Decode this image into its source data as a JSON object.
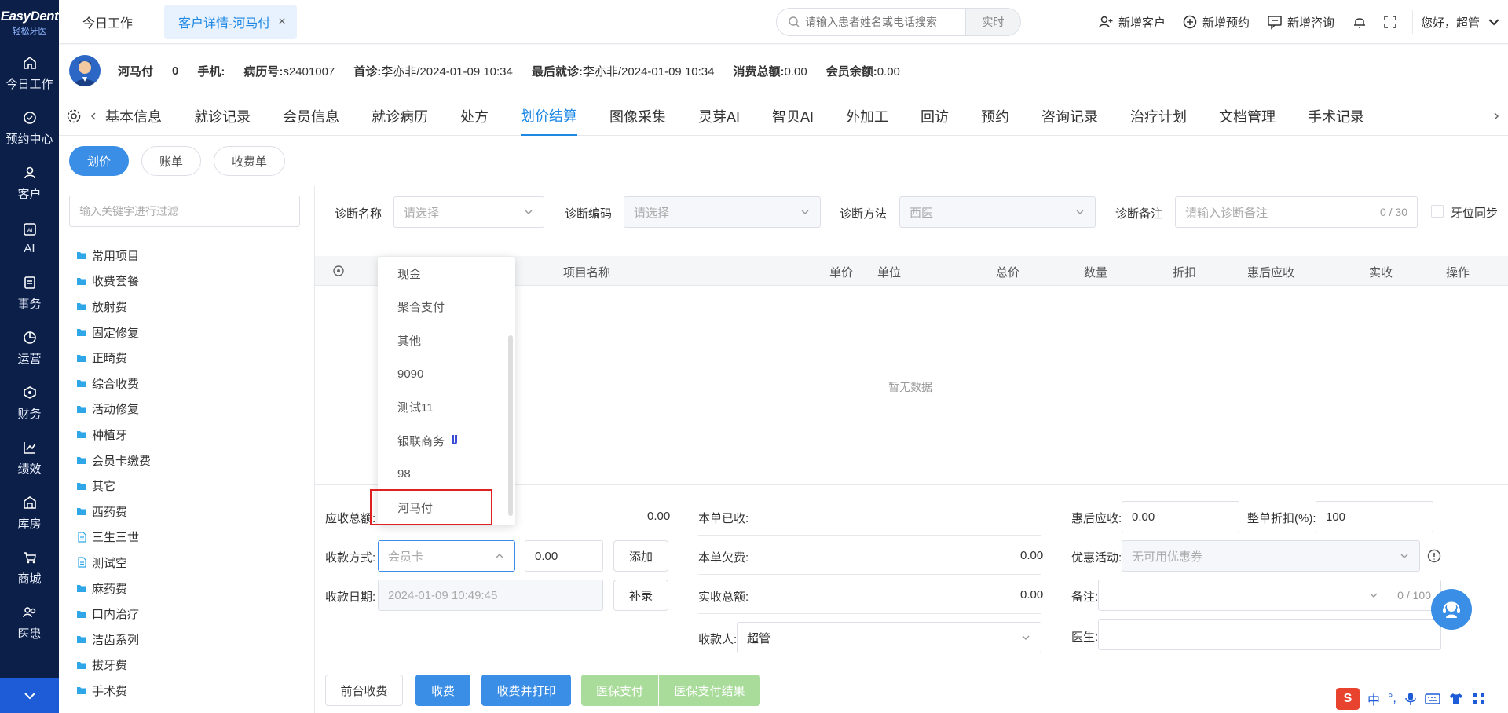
{
  "logo": {
    "line1": "EasyDent",
    "line2": "轻松牙医"
  },
  "leftnav": {
    "items": [
      {
        "label": "今日工作",
        "icon": "home-icon"
      },
      {
        "label": "预约中心",
        "icon": "calendar-icon"
      },
      {
        "label": "客户",
        "icon": "user-icon"
      },
      {
        "label": "AI",
        "icon": "ai-icon"
      },
      {
        "label": "事务",
        "icon": "task-icon"
      },
      {
        "label": "运营",
        "icon": "pie-icon"
      },
      {
        "label": "财务",
        "icon": "wallet-icon"
      },
      {
        "label": "绩效",
        "icon": "chart-icon"
      },
      {
        "label": "库房",
        "icon": "warehouse-icon"
      },
      {
        "label": "商城",
        "icon": "cart-icon"
      },
      {
        "label": "医患",
        "icon": "people-icon"
      }
    ]
  },
  "topbar": {
    "tabs": [
      {
        "label": "今日工作"
      },
      {
        "label": "客户详情-河马付",
        "close": "×"
      }
    ],
    "search": {
      "placeholder": "请输入患者姓名或电话搜索",
      "mode": "实时"
    },
    "actions": {
      "new_customer": "新增客户",
      "new_appointment": "新增预约",
      "new_consult": "新增咨询",
      "greeting": "您好，超管"
    }
  },
  "patient": {
    "name": "河马付",
    "count": "0",
    "phone_label": "手机:",
    "record_label": "病历号:",
    "record_no": "s2401007",
    "first_visit_label": "首诊:",
    "first_visit": "李亦非/2024-01-09 10:34",
    "last_visit_label": "最后就诊:",
    "last_visit": "李亦非/2024-01-09 10:34",
    "total_spend_label": "消费总额:",
    "total_spend": "0.00",
    "member_balance_label": "会员余额:",
    "member_balance": "0.00"
  },
  "module_tabs": [
    "基本信息",
    "就诊记录",
    "会员信息",
    "就诊病历",
    "处方",
    "划价结算",
    "图像采集",
    "灵芽AI",
    "智贝AI",
    "外加工",
    "回访",
    "预约",
    "咨询记录",
    "治疗计划",
    "文档管理",
    "手术记录"
  ],
  "module_tabs_active": "划价结算",
  "sub_tabs": [
    "划价",
    "账单",
    "收费单"
  ],
  "category": {
    "filter_placeholder": "输入关键字进行过滤",
    "items": [
      {
        "label": "常用项目",
        "type": "folder"
      },
      {
        "label": "收费套餐",
        "type": "folder"
      },
      {
        "label": "放射费",
        "type": "folder"
      },
      {
        "label": "固定修复",
        "type": "folder"
      },
      {
        "label": "正畸费",
        "type": "folder"
      },
      {
        "label": "综合收费",
        "type": "folder"
      },
      {
        "label": "活动修复",
        "type": "folder"
      },
      {
        "label": "种植牙",
        "type": "folder"
      },
      {
        "label": "会员卡缴费",
        "type": "folder"
      },
      {
        "label": "其它",
        "type": "folder"
      },
      {
        "label": "西药费",
        "type": "folder"
      },
      {
        "label": "三生三世",
        "type": "file"
      },
      {
        "label": "测试空",
        "type": "file"
      },
      {
        "label": "麻药费",
        "type": "folder"
      },
      {
        "label": "口内治疗",
        "type": "folder"
      },
      {
        "label": "洁齿系列",
        "type": "folder"
      },
      {
        "label": "拔牙费",
        "type": "folder"
      },
      {
        "label": "手术费",
        "type": "folder"
      }
    ]
  },
  "diagnosis": {
    "name_label": "诊断名称",
    "name_placeholder": "请选择",
    "code_label": "诊断编码",
    "code_placeholder": "请选择",
    "method_label": "诊断方法",
    "method_value": "西医",
    "remark_label": "诊断备注",
    "remark_placeholder": "请输入诊断备注",
    "remark_count": "0 / 30",
    "tooth_sync_label": "牙位同步"
  },
  "grid": {
    "headers": [
      "项目名称",
      "单价",
      "单位",
      "总价",
      "数量",
      "折扣",
      "惠后应收",
      "实收",
      "操作"
    ],
    "empty": "暂无数据"
  },
  "summary": {
    "receivable_label": "应收总额:",
    "receivable_value": "0.00",
    "paid_label": "本单已收:",
    "owed_label": "本单欠费:",
    "owed_value": "0.00",
    "actual_label": "实收总额:",
    "actual_value": "0.00",
    "after_discount_label": "惠后应收:",
    "after_discount_value": "0.00",
    "discount_label": "整单折扣(%):",
    "discount_value": "100",
    "promo_label": "优惠活动:",
    "promo_placeholder": "无可用优惠券",
    "remark_label": "备注:",
    "remark_count": "0 / 100",
    "doctor_label": "医生:",
    "pay_method_label": "收款方式:",
    "pay_method_placeholder": "会员卡",
    "pay_amount": "0.00",
    "add_button": "添加",
    "pay_date_label": "收款日期:",
    "pay_date_value": "2024-01-09 10:49:45",
    "backfill_button": "补录",
    "cashier_label": "收款人:",
    "cashier_value": "超管"
  },
  "bottom": {
    "front_desk": "前台收费",
    "charge": "收费",
    "charge_print": "收费并打印",
    "insurance_pay": "医保支付",
    "insurance_result": "医保支付结果"
  },
  "dropdown": {
    "options": [
      "现金",
      "聚合支付",
      "其他",
      "9090",
      "测试11",
      "银联商务",
      "98",
      "河马付"
    ],
    "highlighted": "河马付"
  },
  "ime": {
    "label1": "中",
    "label2": "°,"
  }
}
